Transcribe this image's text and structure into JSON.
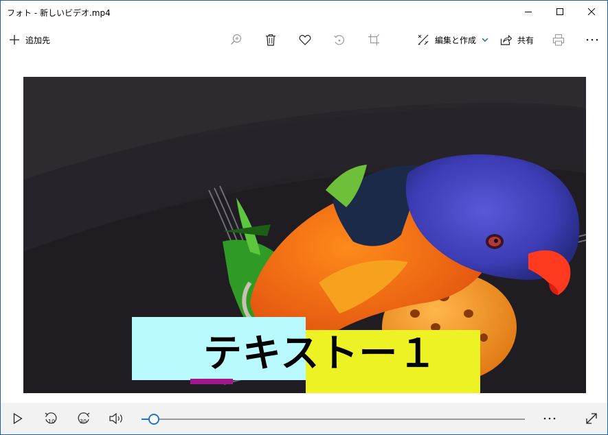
{
  "window": {
    "title": "フォト - 新しいビデオ.mp4",
    "minimize_icon": "minimize-icon",
    "maximize_icon": "maximize-icon",
    "close_icon": "close-icon"
  },
  "toolbar": {
    "add_to_label": "追加先",
    "edit_create_label": "編集と作成",
    "share_label": "共有",
    "icons": [
      "plus-icon",
      "zoom-in-icon",
      "trash-icon",
      "heart-icon",
      "rotate-icon",
      "crop-icon",
      "edit-create-icon",
      "chevron-down-icon",
      "share-icon",
      "print-icon",
      "more-icon"
    ]
  },
  "video": {
    "caption_text": "テキストー１",
    "colors": {
      "cyan_box": "#b8faff",
      "yellow_box": "#ecf224",
      "underline": "#a01890"
    }
  },
  "controls": {
    "skip_back_label": "10",
    "skip_forward_label": "30",
    "progress_fraction": 0.03,
    "icons": [
      "play-icon",
      "skip-back-10-icon",
      "skip-forward-30-icon",
      "volume-icon",
      "more-icon",
      "fullscreen-icon"
    ],
    "accent": "#1a73d0"
  }
}
